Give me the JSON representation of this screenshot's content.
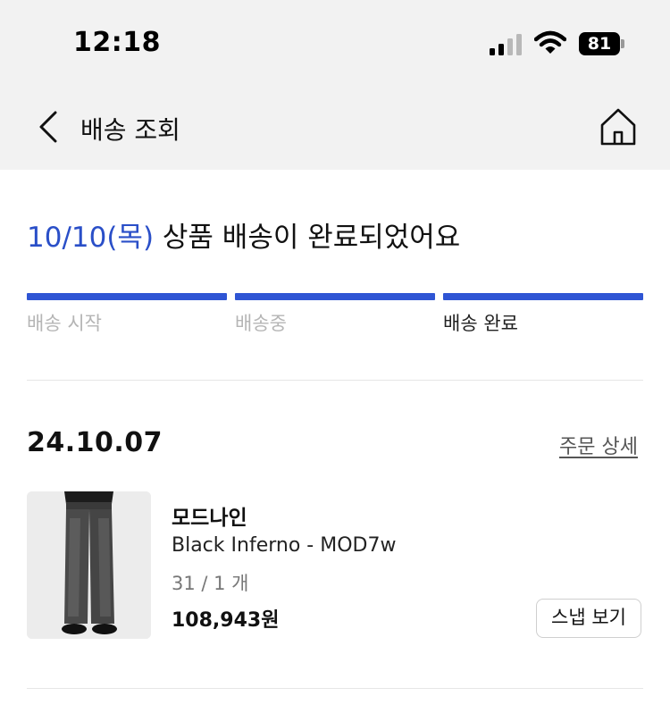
{
  "status_bar": {
    "time": "12:18",
    "battery_level": "81",
    "icons": [
      "cellular-signal-icon",
      "wifi-icon",
      "battery-icon"
    ]
  },
  "nav": {
    "title": "배송 조회",
    "back_icon": "chevron-left-icon",
    "home_icon": "home-icon"
  },
  "delivery": {
    "date": "10/10(목)",
    "message": " 상품 배송이 완료되었어요",
    "accent_color": "#2f55d4",
    "steps": [
      {
        "label": "배송 시작",
        "active": false
      },
      {
        "label": "배송중",
        "active": false
      },
      {
        "label": "배송 완료",
        "active": true
      }
    ],
    "progress_fraction": 1.0
  },
  "order": {
    "date": "24.10.07",
    "detail_link": "주문 상세",
    "item": {
      "brand": "모드나인",
      "name": "Black Inferno - MOD7w",
      "option": "31 / 1 개",
      "price": "108,943원",
      "snap_button": "스냅 보기"
    }
  }
}
